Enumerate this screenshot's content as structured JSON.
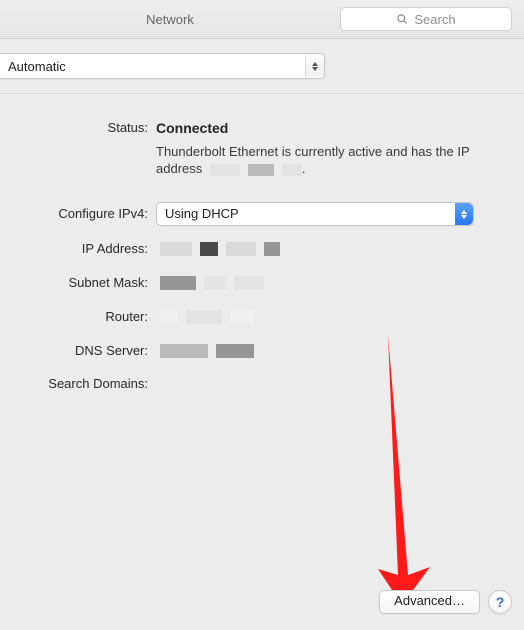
{
  "titlebar": {
    "title": "Network",
    "search_placeholder": "Search"
  },
  "location": {
    "selected": "Automatic"
  },
  "status": {
    "label": "Status:",
    "value": "Connected",
    "description_prefix": "Thunderbolt Ethernet is currently active and has the IP address ",
    "description_suffix": "."
  },
  "settings": {
    "configure_ipv4": {
      "label": "Configure IPv4:",
      "value": "Using DHCP"
    },
    "ip_address": {
      "label": "IP Address:"
    },
    "subnet_mask": {
      "label": "Subnet Mask:"
    },
    "router": {
      "label": "Router:"
    },
    "dns_server": {
      "label": "DNS Server:"
    },
    "search_domains": {
      "label": "Search Domains:"
    }
  },
  "footer": {
    "advanced": "Advanced…",
    "help": "?"
  }
}
